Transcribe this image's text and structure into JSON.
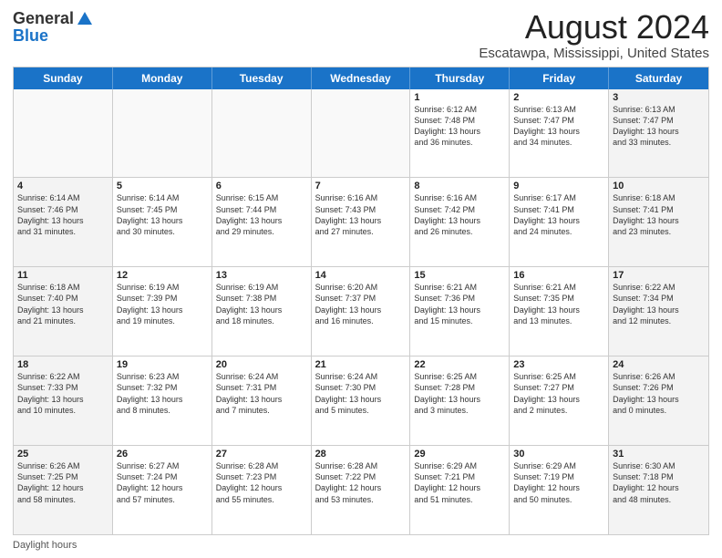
{
  "logo": {
    "general": "General",
    "blue": "Blue"
  },
  "title": "August 2024",
  "subtitle": "Escatawpa, Mississippi, United States",
  "days_of_week": [
    "Sunday",
    "Monday",
    "Tuesday",
    "Wednesday",
    "Thursday",
    "Friday",
    "Saturday"
  ],
  "footer_label": "Daylight hours",
  "weeks": [
    [
      {
        "day": "",
        "text": ""
      },
      {
        "day": "",
        "text": ""
      },
      {
        "day": "",
        "text": ""
      },
      {
        "day": "",
        "text": ""
      },
      {
        "day": "1",
        "text": "Sunrise: 6:12 AM\nSunset: 7:48 PM\nDaylight: 13 hours\nand 36 minutes."
      },
      {
        "day": "2",
        "text": "Sunrise: 6:13 AM\nSunset: 7:47 PM\nDaylight: 13 hours\nand 34 minutes."
      },
      {
        "day": "3",
        "text": "Sunrise: 6:13 AM\nSunset: 7:47 PM\nDaylight: 13 hours\nand 33 minutes."
      }
    ],
    [
      {
        "day": "4",
        "text": "Sunrise: 6:14 AM\nSunset: 7:46 PM\nDaylight: 13 hours\nand 31 minutes."
      },
      {
        "day": "5",
        "text": "Sunrise: 6:14 AM\nSunset: 7:45 PM\nDaylight: 13 hours\nand 30 minutes."
      },
      {
        "day": "6",
        "text": "Sunrise: 6:15 AM\nSunset: 7:44 PM\nDaylight: 13 hours\nand 29 minutes."
      },
      {
        "day": "7",
        "text": "Sunrise: 6:16 AM\nSunset: 7:43 PM\nDaylight: 13 hours\nand 27 minutes."
      },
      {
        "day": "8",
        "text": "Sunrise: 6:16 AM\nSunset: 7:42 PM\nDaylight: 13 hours\nand 26 minutes."
      },
      {
        "day": "9",
        "text": "Sunrise: 6:17 AM\nSunset: 7:41 PM\nDaylight: 13 hours\nand 24 minutes."
      },
      {
        "day": "10",
        "text": "Sunrise: 6:18 AM\nSunset: 7:41 PM\nDaylight: 13 hours\nand 23 minutes."
      }
    ],
    [
      {
        "day": "11",
        "text": "Sunrise: 6:18 AM\nSunset: 7:40 PM\nDaylight: 13 hours\nand 21 minutes."
      },
      {
        "day": "12",
        "text": "Sunrise: 6:19 AM\nSunset: 7:39 PM\nDaylight: 13 hours\nand 19 minutes."
      },
      {
        "day": "13",
        "text": "Sunrise: 6:19 AM\nSunset: 7:38 PM\nDaylight: 13 hours\nand 18 minutes."
      },
      {
        "day": "14",
        "text": "Sunrise: 6:20 AM\nSunset: 7:37 PM\nDaylight: 13 hours\nand 16 minutes."
      },
      {
        "day": "15",
        "text": "Sunrise: 6:21 AM\nSunset: 7:36 PM\nDaylight: 13 hours\nand 15 minutes."
      },
      {
        "day": "16",
        "text": "Sunrise: 6:21 AM\nSunset: 7:35 PM\nDaylight: 13 hours\nand 13 minutes."
      },
      {
        "day": "17",
        "text": "Sunrise: 6:22 AM\nSunset: 7:34 PM\nDaylight: 13 hours\nand 12 minutes."
      }
    ],
    [
      {
        "day": "18",
        "text": "Sunrise: 6:22 AM\nSunset: 7:33 PM\nDaylight: 13 hours\nand 10 minutes."
      },
      {
        "day": "19",
        "text": "Sunrise: 6:23 AM\nSunset: 7:32 PM\nDaylight: 13 hours\nand 8 minutes."
      },
      {
        "day": "20",
        "text": "Sunrise: 6:24 AM\nSunset: 7:31 PM\nDaylight: 13 hours\nand 7 minutes."
      },
      {
        "day": "21",
        "text": "Sunrise: 6:24 AM\nSunset: 7:30 PM\nDaylight: 13 hours\nand 5 minutes."
      },
      {
        "day": "22",
        "text": "Sunrise: 6:25 AM\nSunset: 7:28 PM\nDaylight: 13 hours\nand 3 minutes."
      },
      {
        "day": "23",
        "text": "Sunrise: 6:25 AM\nSunset: 7:27 PM\nDaylight: 13 hours\nand 2 minutes."
      },
      {
        "day": "24",
        "text": "Sunrise: 6:26 AM\nSunset: 7:26 PM\nDaylight: 13 hours\nand 0 minutes."
      }
    ],
    [
      {
        "day": "25",
        "text": "Sunrise: 6:26 AM\nSunset: 7:25 PM\nDaylight: 12 hours\nand 58 minutes."
      },
      {
        "day": "26",
        "text": "Sunrise: 6:27 AM\nSunset: 7:24 PM\nDaylight: 12 hours\nand 57 minutes."
      },
      {
        "day": "27",
        "text": "Sunrise: 6:28 AM\nSunset: 7:23 PM\nDaylight: 12 hours\nand 55 minutes."
      },
      {
        "day": "28",
        "text": "Sunrise: 6:28 AM\nSunset: 7:22 PM\nDaylight: 12 hours\nand 53 minutes."
      },
      {
        "day": "29",
        "text": "Sunrise: 6:29 AM\nSunset: 7:21 PM\nDaylight: 12 hours\nand 51 minutes."
      },
      {
        "day": "30",
        "text": "Sunrise: 6:29 AM\nSunset: 7:19 PM\nDaylight: 12 hours\nand 50 minutes."
      },
      {
        "day": "31",
        "text": "Sunrise: 6:30 AM\nSunset: 7:18 PM\nDaylight: 12 hours\nand 48 minutes."
      }
    ]
  ]
}
